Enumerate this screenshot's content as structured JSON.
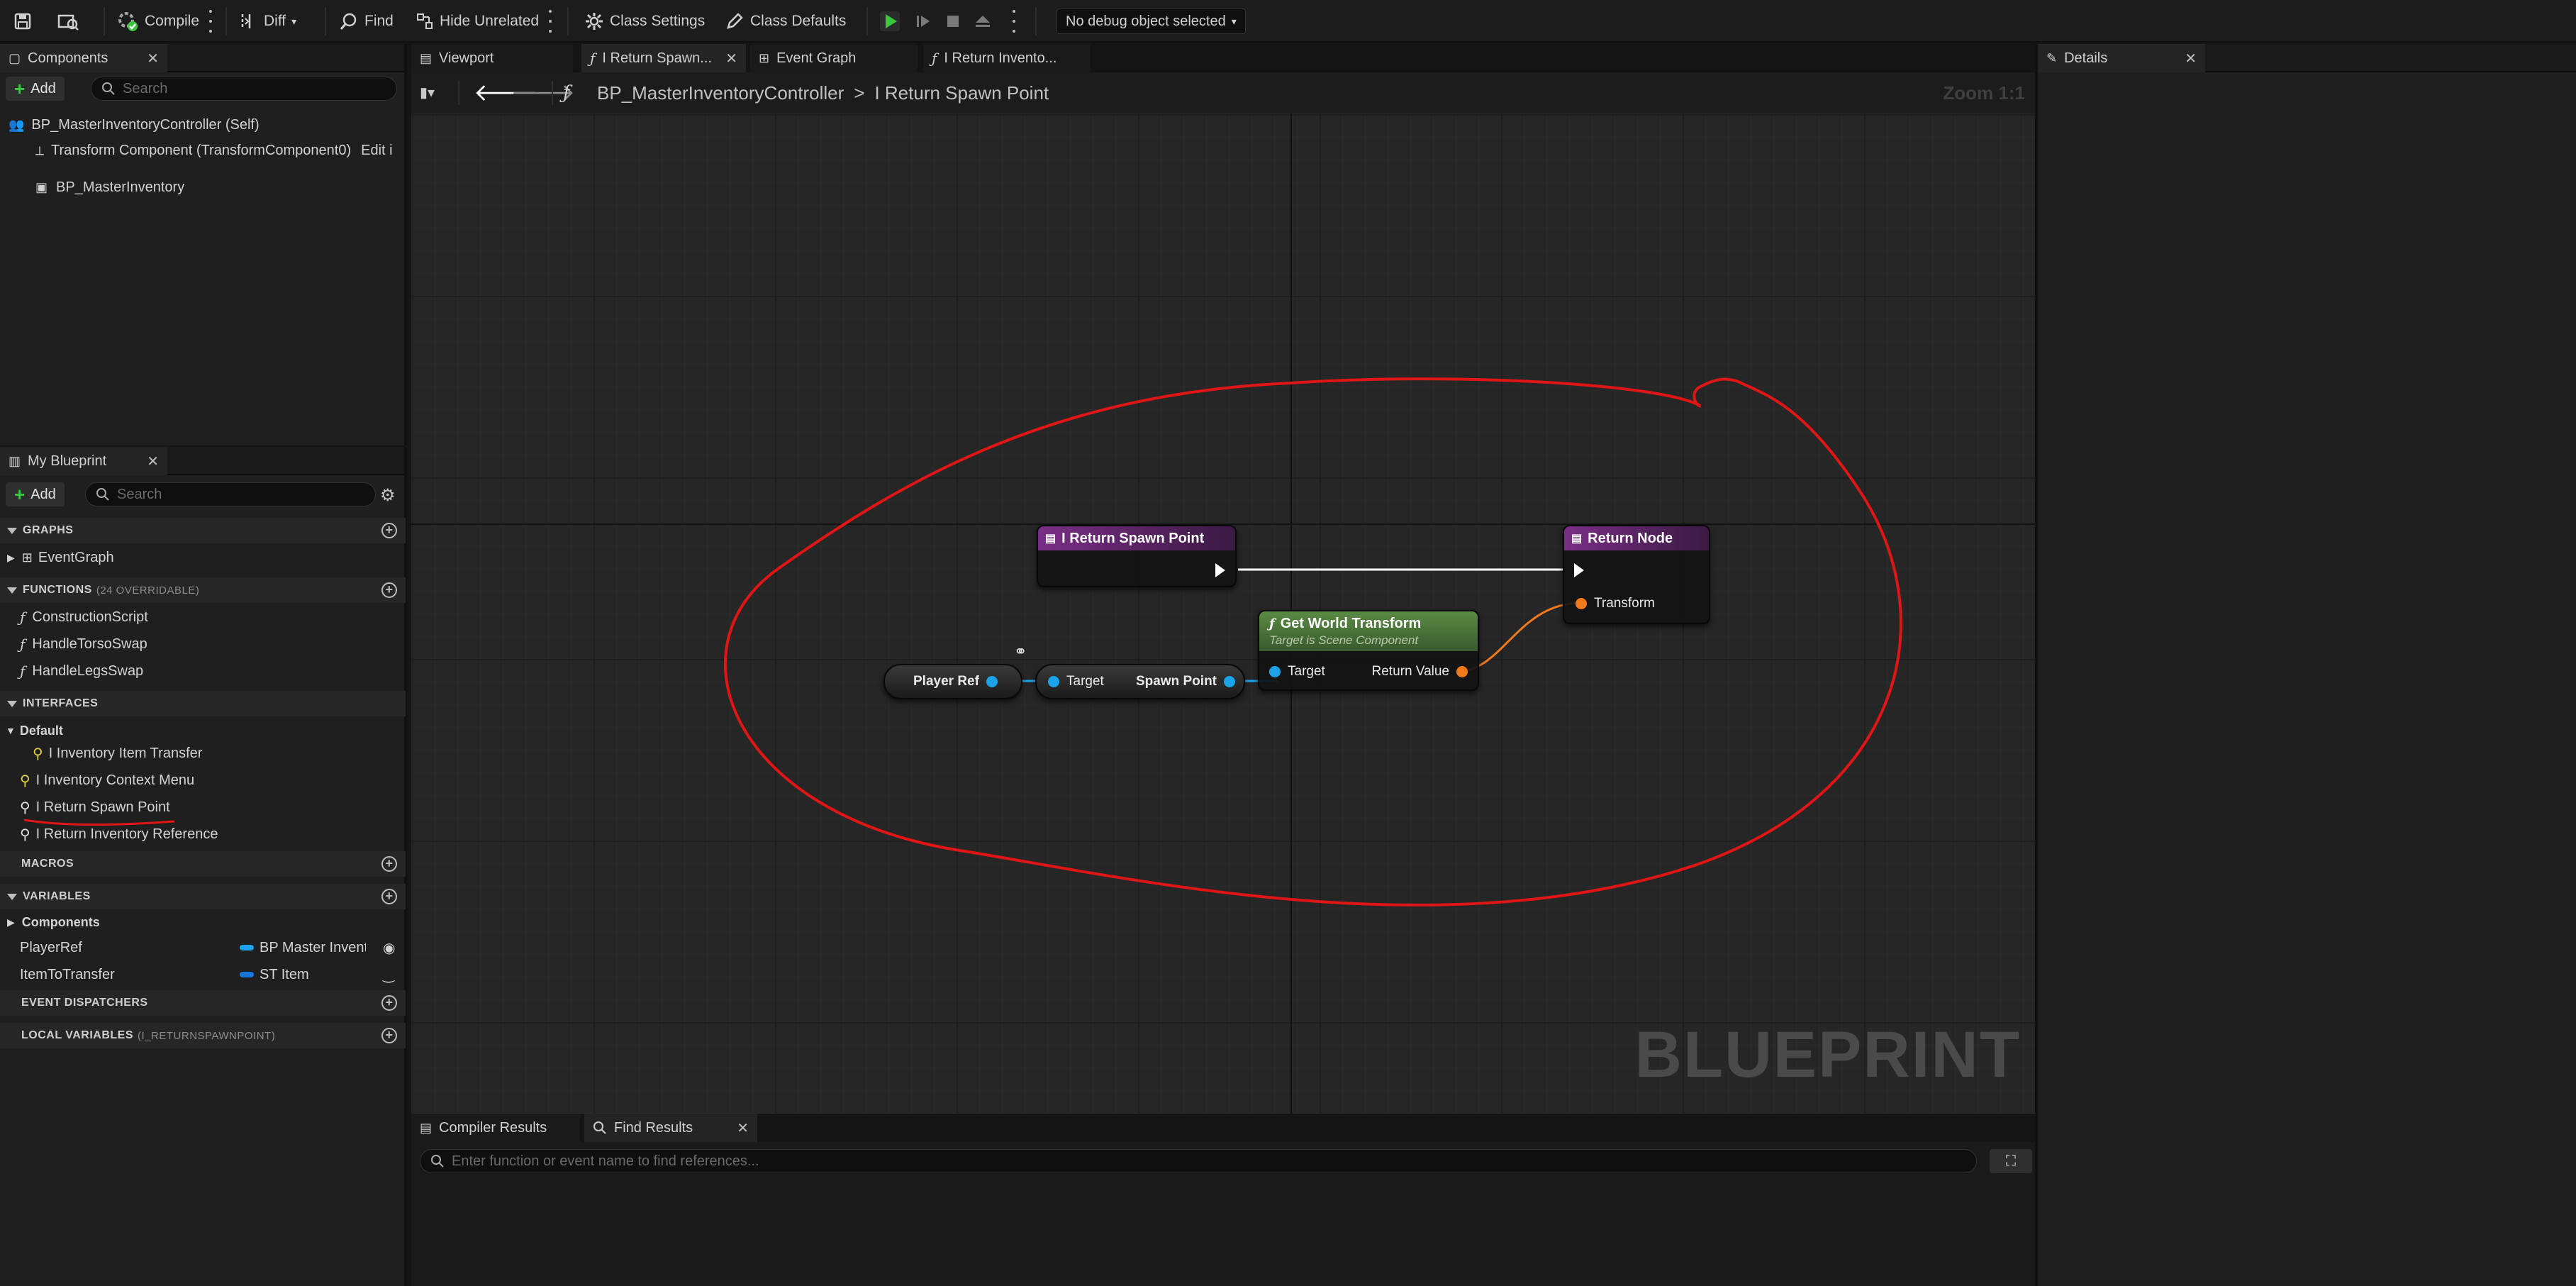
{
  "toolbar": {
    "compile": "Compile",
    "diff": "Diff",
    "find": "Find",
    "hide_unrelated": "Hide Unrelated",
    "class_settings": "Class Settings",
    "class_defaults": "Class Defaults",
    "debug_object": "No debug object selected"
  },
  "components": {
    "tab": "Components",
    "add": "Add",
    "search_placeholder": "Search",
    "root": "BP_MasterInventoryController (Self)",
    "transform": "Transform Component (TransformComponent0)",
    "edit": "Edit i",
    "child": "BP_MasterInventory"
  },
  "my_blueprint": {
    "tab": "My Blueprint",
    "add": "Add",
    "search_placeholder": "Search",
    "graphs_header": "GRAPHS",
    "graphs": [
      "EventGraph"
    ],
    "functions_header": "FUNCTIONS",
    "functions_sub": "(24 OVERRIDABLE)",
    "functions": [
      "ConstructionScript",
      "HandleTorsoSwap",
      "HandleLegsSwap"
    ],
    "interfaces_header": "INTERFACES",
    "interfaces_default": "Default",
    "interfaces": [
      "I Inventory Item Transfer",
      "I Inventory Context Menu",
      "I Return Spawn Point",
      "I Return Inventory Reference"
    ],
    "macros_header": "MACROS",
    "variables_header": "VARIABLES",
    "variables_group": "Components",
    "variables": [
      {
        "name": "PlayerRef",
        "type": "BP Master Invento"
      },
      {
        "name": "ItemToTransfer",
        "type": "ST Item"
      }
    ],
    "dispatchers_header": "EVENT DISPATCHERS",
    "locals_header": "LOCAL VARIABLES",
    "locals_sub": "(I_RETURNSPAWNPOINT)"
  },
  "tabs": {
    "viewport": "Viewport",
    "return_spawn": "I Return Spawn...",
    "event_graph": "Event Graph",
    "return_inventory": "I Return Invento..."
  },
  "breadcrumb": {
    "root": "BP_MasterInventoryController",
    "separator": ">",
    "current": "I Return Spawn Point",
    "zoom": "Zoom 1:1"
  },
  "graph": {
    "watermark": "BLUEPRINT",
    "entry_node": "I Return Spawn Point",
    "return_node": "Return Node",
    "return_pin": "Transform",
    "gwt_title": "Get World Transform",
    "gwt_subtitle": "Target is Scene Component",
    "gwt_target": "Target",
    "gwt_return": "Return Value",
    "player_ref": "Player Ref",
    "get_target": "Target",
    "spawn_point": "Spawn Point"
  },
  "details": {
    "tab": "Details"
  },
  "bottom": {
    "compiler_results": "Compiler Results",
    "find_results": "Find Results",
    "find_placeholder": "Enter function or event name to find references..."
  },
  "colors": {
    "accent_green": "#3cc63c",
    "function_header": "#7a2e86",
    "pure_header": "#4f7a3a",
    "object_pin": "#1aa3e8",
    "struct_pin": "#f07a1a",
    "annotation_red": "#e01515"
  }
}
